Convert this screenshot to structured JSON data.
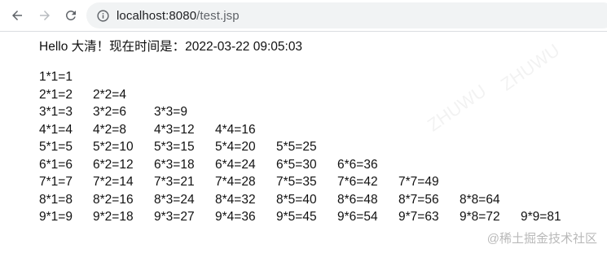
{
  "browser": {
    "url_host": "localhost:8080",
    "url_path": "/test.jsp",
    "icons": {
      "back": "arrow-left-icon",
      "forward": "arrow-right-icon",
      "reload": "reload-icon",
      "info": "info-circle-icon"
    }
  },
  "page": {
    "greeting": "Hello 大清！现在时间是：2022-03-22 09:05:03",
    "table": [
      [
        "1*1=1"
      ],
      [
        "2*1=2",
        "2*2=4"
      ],
      [
        "3*1=3",
        "3*2=6",
        "3*3=9"
      ],
      [
        "4*1=4",
        "4*2=8",
        "4*3=12",
        "4*4=16"
      ],
      [
        "5*1=5",
        "5*2=10",
        "5*3=15",
        "5*4=20",
        "5*5=25"
      ],
      [
        "6*1=6",
        "6*2=12",
        "6*3=18",
        "6*4=24",
        "6*5=30",
        "6*6=36"
      ],
      [
        "7*1=7",
        "7*2=14",
        "7*3=21",
        "7*4=28",
        "7*5=35",
        "7*6=42",
        "7*7=49"
      ],
      [
        "8*1=8",
        "8*2=16",
        "8*3=24",
        "8*4=32",
        "8*5=40",
        "8*6=48",
        "8*7=56",
        "8*8=64"
      ],
      [
        "9*1=9",
        "9*2=18",
        "9*3=27",
        "9*4=36",
        "9*5=45",
        "9*6=54",
        "9*7=63",
        "9*8=72",
        "9*9=81"
      ]
    ]
  },
  "watermark": "@稀土掘金技术社区"
}
